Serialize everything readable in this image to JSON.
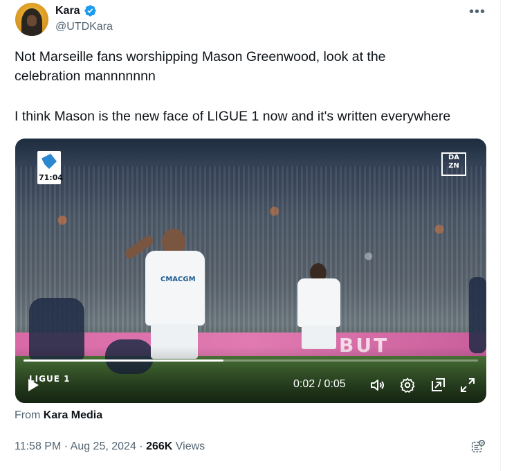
{
  "author": {
    "name": "Kara",
    "handle": "@UTDKara"
  },
  "tweet": {
    "line1": "Not Marseille fans worshipping Mason Greenwood, look at the",
    "line2": "celebration mannnnnnn",
    "line3": "I think Mason is the new face of LIGUE 1 now and it's written everywhere"
  },
  "video": {
    "match_clock": "71:04",
    "broadcaster": "DAZN",
    "broadcaster_line1": "DA",
    "broadcaster_line2": "ZN",
    "sponsor": "CMACGM",
    "board_text": "BUT",
    "league_logo": "LIGUE 1",
    "time_display": "0:02 / 0:05",
    "progress_fraction": 0.44
  },
  "source": {
    "prefix": "From",
    "name": "Kara Media"
  },
  "meta": {
    "time": "11:58 PM",
    "sep1": "·",
    "date": "Aug 25, 2024",
    "sep2": "·",
    "views_count": "266K",
    "views_label": "Views"
  },
  "colors": {
    "verified": "#1d9bf0",
    "secondary_text": "#536471",
    "primary_text": "#0f1419"
  },
  "icons": {
    "more": "more-horizontal-icon",
    "verified": "verified-badge-icon",
    "play": "play-icon",
    "volume": "volume-icon",
    "settings": "gear-icon",
    "pip": "picture-in-picture-icon",
    "fullscreen": "fullscreen-icon",
    "analytics": "analytics-icon"
  }
}
